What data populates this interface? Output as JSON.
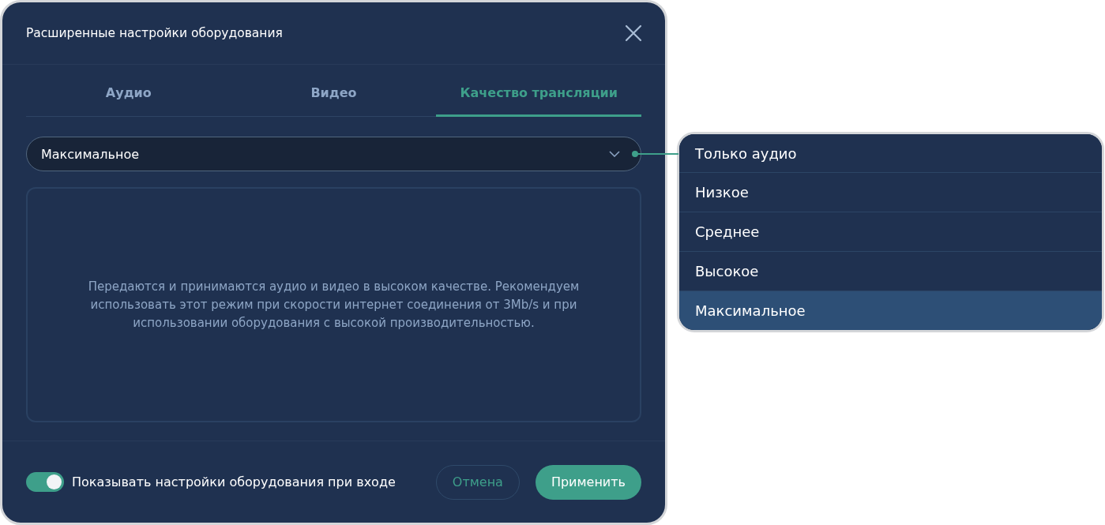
{
  "dialog": {
    "title": "Расширенные настройки оборудования",
    "tabs": [
      {
        "label": "Аудио",
        "selected": false
      },
      {
        "label": "Видео",
        "selected": false
      },
      {
        "label": "Качество трансляции",
        "selected": true
      }
    ],
    "quality_select": {
      "value": "Максимальное",
      "expanded": true
    },
    "description": "Передаются и принимаются аудио и видео в высоком качестве. Рекомендуем использовать этот режим при скорости интернет соединения от 3Mb/s и при использовании оборудования с высокой производительностью.",
    "show_on_login": {
      "label": "Показывать настройки оборудования при входе",
      "on": true
    },
    "buttons": [
      {
        "kind": "secondary",
        "label": "Отмена"
      },
      {
        "kind": "primary",
        "label": "Применить"
      }
    ]
  },
  "dropdown_options": [
    {
      "label": "Только аудио",
      "selected": false
    },
    {
      "label": "Низкое",
      "selected": false
    },
    {
      "label": "Среднее",
      "selected": false
    },
    {
      "label": "Высокое",
      "selected": false
    },
    {
      "label": "Максимальное",
      "selected": true
    }
  ]
}
